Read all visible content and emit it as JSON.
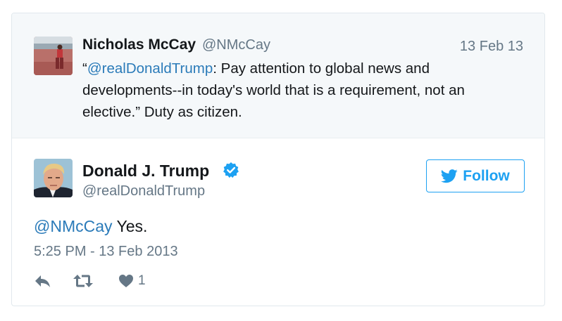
{
  "quoted_tweet": {
    "name": "Nicholas McCay",
    "handle": "@NMcCay",
    "date": "13 Feb 13",
    "text_open_quote": "“",
    "text_mention": "@realDonaldTrump",
    "text_body": ": Pay attention to global news and developments--in today's world that is a requirement, not an elective.” Duty as citizen."
  },
  "main_tweet": {
    "name": "Donald J. Trump",
    "handle": "@realDonaldTrump",
    "follow_label": "Follow",
    "text_mention": "@NMcCay",
    "text_body": " Yes.",
    "timestamp": "5:25 PM - 13 Feb 2013",
    "like_count": "1"
  },
  "colors": {
    "accent": "#1da1f2",
    "mention": "#2b7bb9",
    "secondary_text": "#657786",
    "quoted_bg": "#f5f8fa",
    "border": "#e1e8ed"
  },
  "icons": {
    "verified": "verified-badge-icon",
    "follow": "twitter-bird-icon",
    "reply": "reply-icon",
    "retweet": "retweet-icon",
    "like": "heart-icon"
  }
}
